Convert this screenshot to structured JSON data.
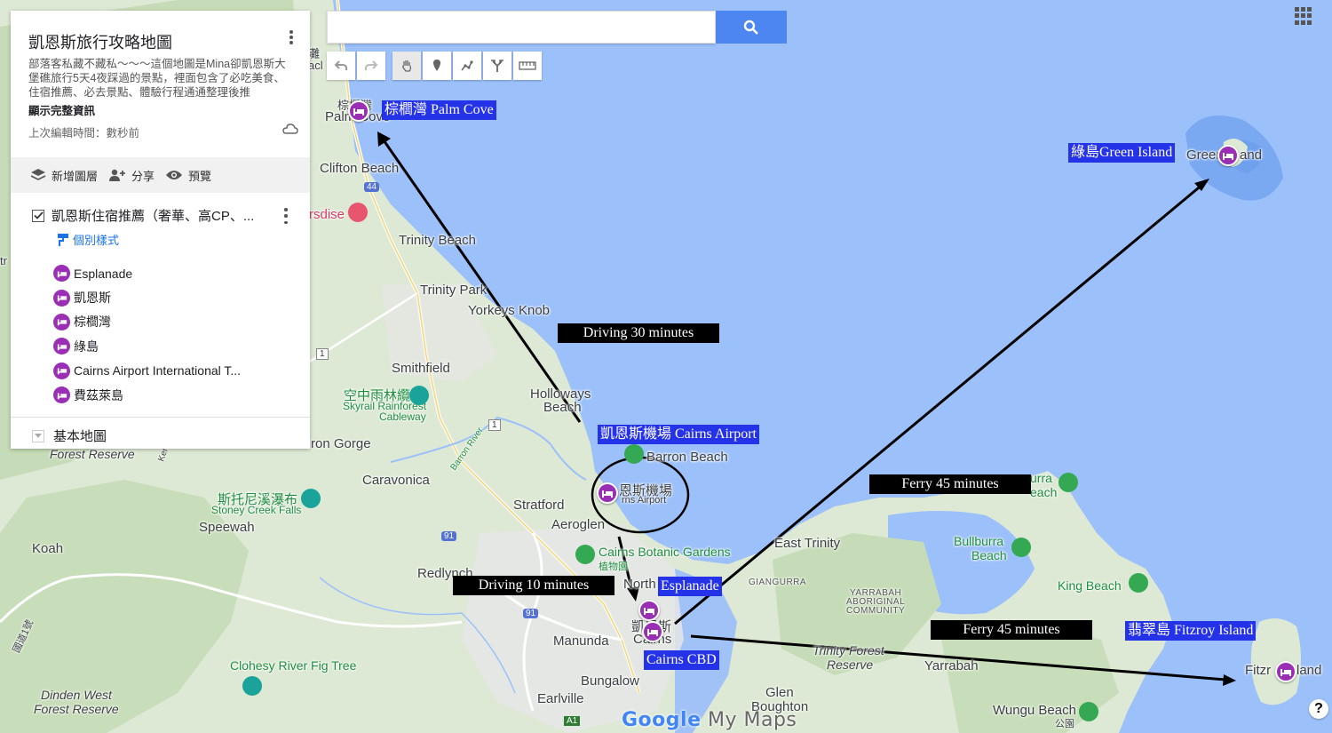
{
  "panel": {
    "title": "凱恩斯旅行攻略地圖",
    "description": "部落客私藏不藏私～～～這個地圖是Mina卻凱恩斯大堡礁旅行5天4夜踩過的景點，裡面包含了必吃美食、住宿推薦、必去景點、體驗行程通通整理後推",
    "show_more": "顯示完整資訊",
    "last_edit": "上次編輯時間：數秒前",
    "actions": {
      "add_layer": "新增圖層",
      "share": "分享",
      "preview": "預覽"
    },
    "layer": {
      "title": "凱恩斯住宿推薦（奢華、高CP、...",
      "checked": true,
      "style_link": "個別樣式",
      "items": [
        "Esplanade",
        "凱恩斯",
        "棕櫚灣",
        "綠島",
        "Cairns Airport International T...",
        "費茲萊島"
      ]
    },
    "base_map": "基本地圖"
  },
  "search": {
    "placeholder": "",
    "value": ""
  },
  "map": {
    "blue_labels": {
      "palm_cove": "棕櫚灣 Palm Cove",
      "green_island": "綠島Green Island",
      "airport": "凱恩斯機場 Cairns Airport",
      "esplanade": "Esplanade",
      "cairns_cbd": "Cairns CBD",
      "fitzroy": "翡翠島 Fitzroy Island"
    },
    "route_labels": {
      "drive30": "Driving 30 minutes",
      "drive10": "Driving 10 minutes",
      "ferry_green": "Ferry 45 minutes",
      "ferry_fitzroy": "Ferry 45 minutes"
    },
    "places": {
      "palm_cove_base": "Palm Cove",
      "palm_cove_cn": "棕櫚灣",
      "clifton": "Clifton Beach",
      "trinity_beach": "Trinity Beach",
      "trinity_park": "Trinity Park",
      "yorkeys": "Yorkeys Knob",
      "smithfield": "Smithfield",
      "holloways": "Holloways",
      "holloways2": "Beach",
      "skyrail_cn": "空中雨林纜車",
      "skyrail_en1": "Skyrail Rainforest",
      "skyrail_en2": "Cableway",
      "barron_beach": "Barron Beach",
      "barron_river": "Barron River",
      "airport_cn": "恩斯機場",
      "airport_en": "rns Airport",
      "caravonica": "Caravonica",
      "stratford": "Stratford",
      "aeroglen": "Aeroglen",
      "botanic": "Cairns Botanic Gardens",
      "botanic_cn": "植物園",
      "north": "North",
      "redlynch": "Redlynch",
      "manunda": "Manunda",
      "cairns_cn": "凱恩斯",
      "cairns_en": "Cairns",
      "bungalow": "Bungalow",
      "earlville": "Earlville",
      "east_trinity": "East Trinity",
      "giangurra": "GIANGURRA",
      "yarrabah_ac1": "YARRABAH",
      "yarrabah_ac2": "ABORIGINAL",
      "yarrabah_ac3": "COMMUNITY",
      "yarrabah": "Yarrabah",
      "trinity_forest1": "Trinity Forest",
      "trinity_forest2": "Reserve",
      "glen1": "Glen",
      "glen2": "Boughton",
      "wungu": "Wungu Beach",
      "wungu_cn": "公園",
      "bullburra": "Bullburra",
      "bullburra2": "Beach",
      "bullburra_top": "urra",
      "bullburra_top2": "each",
      "king_beach": "King Beach",
      "green_isl_map": "Greer",
      "green_isl_map2": "and",
      "fitz_map": "Fitzr",
      "fitz_map2": "land",
      "stoney_cn": "斯托尼溪瀑布",
      "stoney_en": "Stoney Creek Falls",
      "speewah": "Speewah",
      "koah": "Koah",
      "forest_reserve": "Forest Reserve",
      "kenne": "Kenne",
      "barron_gorge": "ron Gorge",
      "clohesy": "Clohesy River Fig Tree",
      "dinden1": "Dinden West",
      "dinden2": "Forest Reserve",
      "rsdise": "rsdise",
      "nat_hwy": "國道1號",
      "hw_44": "44",
      "hw_1": "1",
      "hw_1b": "1",
      "hw_91": "91",
      "hw_91b": "91",
      "a1": "A1",
      "top_cn": "灘",
      "top_en": "acl",
      "tr": "tr"
    },
    "watermark": {
      "google": "Google",
      "my_maps": "My Maps"
    },
    "colors": {
      "water": "#9cc0f9",
      "land": "#dde9d4",
      "pin": "#9a2fb5",
      "tag_blue": "#2432e8"
    }
  }
}
